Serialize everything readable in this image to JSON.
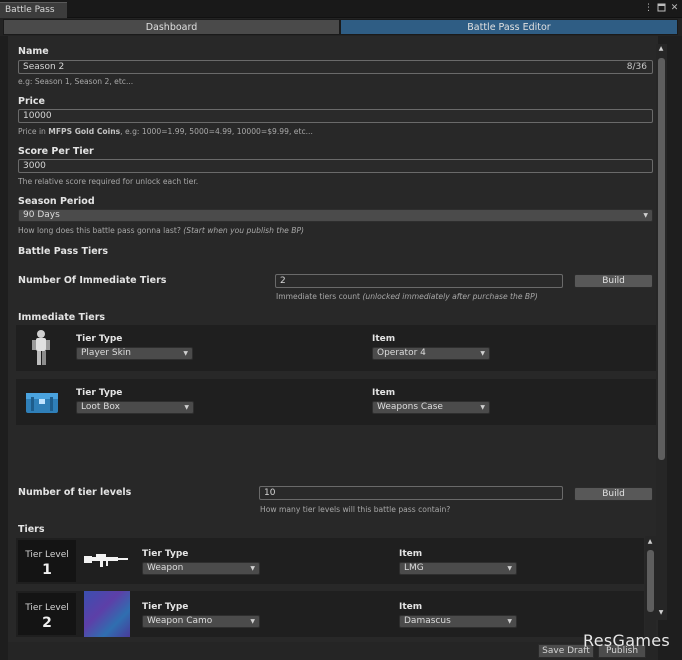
{
  "window": {
    "title": "Battle Pass",
    "controls": [
      "kebab-menu-icon",
      "maximize-icon",
      "close-icon"
    ]
  },
  "tabs": [
    {
      "label": "Dashboard",
      "active": false
    },
    {
      "label": "Battle Pass Editor",
      "active": true
    }
  ],
  "form": {
    "name_label": "Name",
    "name_value": "Season 2",
    "name_counter": "8/36",
    "name_hint": "e.g: Season 1, Season 2, etc...",
    "price_label": "Price",
    "price_value": "10000",
    "price_hint_a": "Price in ",
    "price_hint_b": "MFPS Gold Coins",
    "price_hint_c": ", e.g: 1000=1.99, 5000=4.99, 10000=$9.99, etc...",
    "score_label": "Score Per Tier",
    "score_value": "3000",
    "score_hint": "The relative score required for unlock each tier.",
    "period_label": "Season Period",
    "period_value": "90 Days",
    "period_hint_a": "How long does this battle pass gonna last? ",
    "period_hint_b": "(Start when you publish the BP)",
    "tiers_section": "Battle Pass Tiers",
    "immediate_label": "Number Of Immediate Tiers",
    "immediate_value": "2",
    "immediate_hint_a": "Immediate tiers count ",
    "immediate_hint_b": "(unlocked immediately after purchase the BP)",
    "build_label": "Build",
    "immediate_section": "Immediate Tiers",
    "levels_label": "Number of tier levels",
    "levels_value": "10",
    "levels_hint": "How many tier levels will this battle pass contain?",
    "tiers_label": "Tiers"
  },
  "immediate_tiers": [
    {
      "tier_type_label": "Tier Type",
      "tier_type": "Player Skin",
      "item_label": "Item",
      "item": "Operator 4",
      "icon": "player-skin-icon"
    },
    {
      "tier_type_label": "Tier Type",
      "tier_type": "Loot Box",
      "item_label": "Item",
      "item": "Weapons Case",
      "icon": "loot-box-icon"
    }
  ],
  "tiers": [
    {
      "level_label": "Tier Level",
      "level": "1",
      "tier_type_label": "Tier Type",
      "tier_type": "Weapon",
      "item_label": "Item",
      "item": "LMG",
      "icon": "rifle-icon"
    },
    {
      "level_label": "Tier Level",
      "level": "2",
      "tier_type_label": "Tier Type",
      "tier_type": "Weapon Camo",
      "item_label": "Item",
      "item": "Damascus",
      "icon": "camo-swatch-icon"
    }
  ],
  "footer": {
    "save_draft": "Save Draft",
    "publish": "Publish"
  },
  "watermark": "ResGames",
  "colors": {
    "active_tab": "#2f5d84",
    "panel": "#282828",
    "card": "#1f1f1f",
    "field_border": "#6a6a6a"
  }
}
